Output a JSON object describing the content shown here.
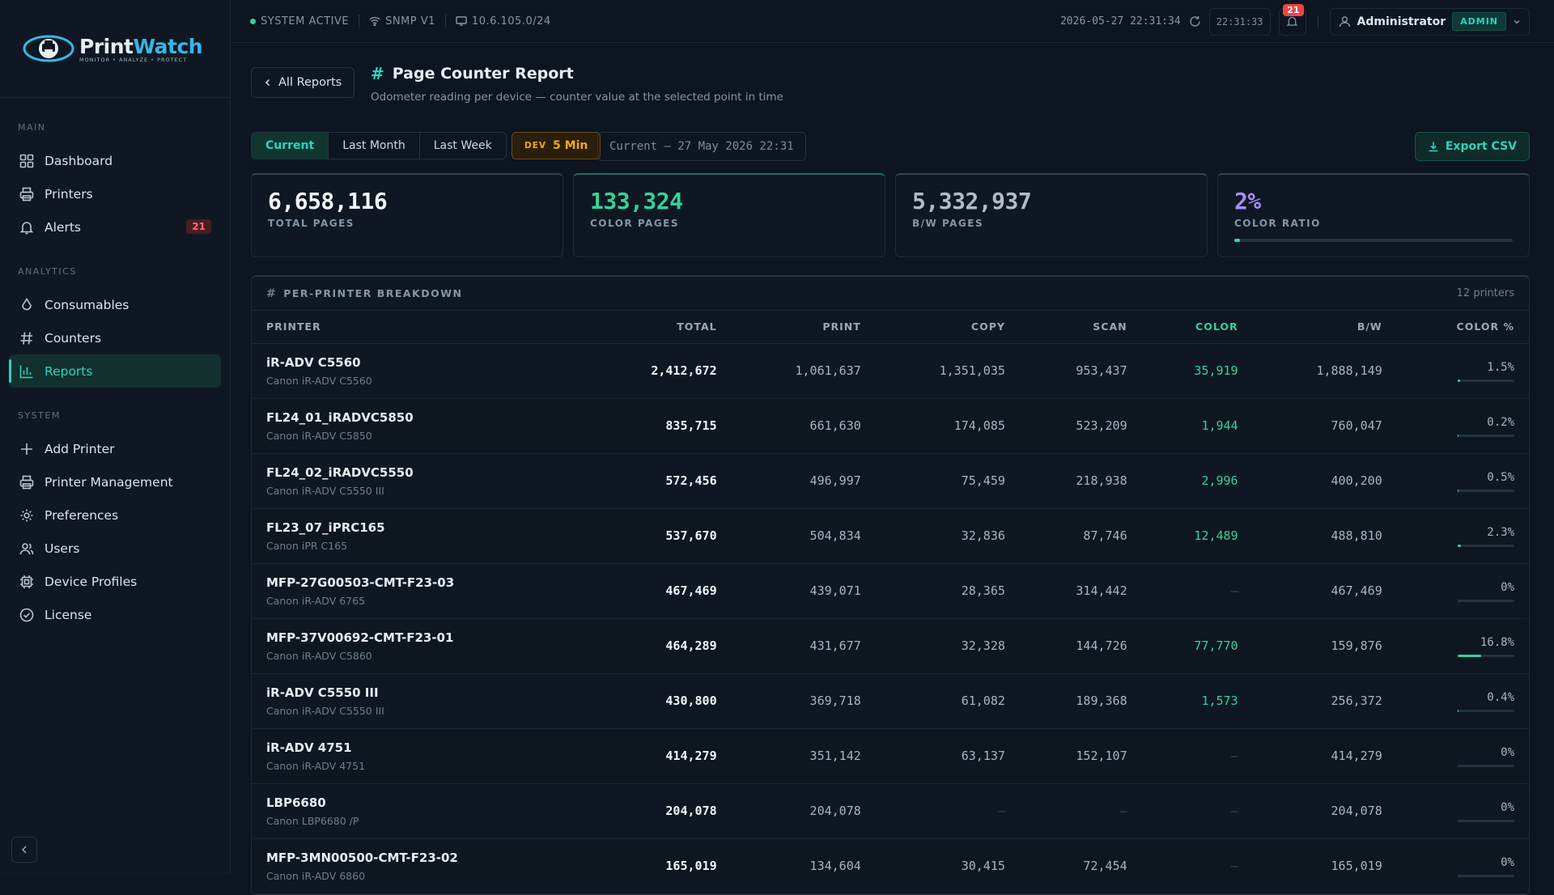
{
  "brand": {
    "name_part1": "Print",
    "name_part2": "Watch",
    "tagline": "MONITOR • ANALYZE • PROTECT"
  },
  "sidebar": {
    "sections": [
      {
        "label": "MAIN",
        "items": [
          {
            "label": "Dashboard",
            "icon": "grid-icon"
          },
          {
            "label": "Printers",
            "icon": "printer-icon"
          },
          {
            "label": "Alerts",
            "icon": "bell-icon",
            "badge": "21"
          }
        ]
      },
      {
        "label": "ANALYTICS",
        "items": [
          {
            "label": "Consumables",
            "icon": "droplet-icon"
          },
          {
            "label": "Counters",
            "icon": "hash-icon"
          },
          {
            "label": "Reports",
            "icon": "bar-chart-icon",
            "active": true
          }
        ]
      },
      {
        "label": "SYSTEM",
        "items": [
          {
            "label": "Add Printer",
            "icon": "plus-icon"
          },
          {
            "label": "Printer Management",
            "icon": "printer-icon"
          },
          {
            "label": "Preferences",
            "icon": "gear-icon"
          },
          {
            "label": "Users",
            "icon": "users-icon"
          },
          {
            "label": "Device Profiles",
            "icon": "chip-icon"
          },
          {
            "label": "License",
            "icon": "check-circle-icon"
          }
        ]
      }
    ]
  },
  "topbar": {
    "status": "SYSTEM ACTIVE",
    "protocol": "SNMP V1",
    "subnet": "10.6.105.0/24",
    "datetime": "2026-05-27 22:31:34",
    "refresh_time": "22:31:33",
    "notifications": "21",
    "user": "Administrator",
    "role": "ADMIN"
  },
  "header": {
    "back_label": "All Reports",
    "title": "Page Counter Report",
    "subtitle": "Odometer reading per device — counter value at the selected point in time"
  },
  "filters": {
    "periods": [
      "Current",
      "Last Month",
      "Last Week"
    ],
    "active_period": "Current",
    "dev_tag": "DEV",
    "dev_label": "5 Min",
    "date_value": "Current — 27 May 2026 22:31",
    "export_label": "Export CSV"
  },
  "stats": {
    "total_pages": {
      "value": "6,658,116",
      "label": "TOTAL PAGES"
    },
    "color_pages": {
      "value": "133,324",
      "label": "COLOR PAGES"
    },
    "bw_pages": {
      "value": "5,332,937",
      "label": "B/W PAGES"
    },
    "color_ratio": {
      "value": "2%",
      "label": "COLOR RATIO",
      "fraction": 0.02
    }
  },
  "breakdown": {
    "title": "PER-PRINTER BREAKDOWN",
    "count": "12 printers",
    "columns": [
      "PRINTER",
      "TOTAL",
      "PRINT",
      "COPY",
      "SCAN",
      "COLOR",
      "B/W",
      "COLOR %"
    ],
    "rows": [
      {
        "name": "iR-ADV C5560",
        "model": "Canon iR-ADV C5560",
        "total": "2,412,672",
        "print": "1,061,637",
        "copy": "1,351,035",
        "scan": "953,437",
        "color": "35,919",
        "bw": "1,888,149",
        "pct": "1.5%",
        "pct_num": 1.5
      },
      {
        "name": "FL24_01_iRADVC5850",
        "model": "Canon iR-ADV C5850",
        "total": "835,715",
        "print": "661,630",
        "copy": "174,085",
        "scan": "523,209",
        "color": "1,944",
        "bw": "760,047",
        "pct": "0.2%",
        "pct_num": 0.2
      },
      {
        "name": "FL24_02_iRADVC5550",
        "model": "Canon iR-ADV C5550 III",
        "total": "572,456",
        "print": "496,997",
        "copy": "75,459",
        "scan": "218,938",
        "color": "2,996",
        "bw": "400,200",
        "pct": "0.5%",
        "pct_num": 0.5
      },
      {
        "name": "FL23_07_iPRC165",
        "model": "Canon iPR C165",
        "total": "537,670",
        "print": "504,834",
        "copy": "32,836",
        "scan": "87,746",
        "color": "12,489",
        "bw": "488,810",
        "pct": "2.3%",
        "pct_num": 2.3
      },
      {
        "name": "MFP-27G00503-CMT-F23-03",
        "model": "Canon iR-ADV 6765",
        "total": "467,469",
        "print": "439,071",
        "copy": "28,365",
        "scan": "314,442",
        "color": "—",
        "bw": "467,469",
        "pct": "0%",
        "pct_num": 0
      },
      {
        "name": "MFP-37V00692-CMT-F23-01",
        "model": "Canon iR-ADV C5860",
        "total": "464,289",
        "print": "431,677",
        "copy": "32,328",
        "scan": "144,726",
        "color": "77,770",
        "bw": "159,876",
        "pct": "16.8%",
        "pct_num": 16.8
      },
      {
        "name": "iR-ADV C5550 III",
        "model": "Canon iR-ADV C5550 III",
        "total": "430,800",
        "print": "369,718",
        "copy": "61,082",
        "scan": "189,368",
        "color": "1,573",
        "bw": "256,372",
        "pct": "0.4%",
        "pct_num": 0.4
      },
      {
        "name": "iR-ADV 4751",
        "model": "Canon iR-ADV 4751",
        "total": "414,279",
        "print": "351,142",
        "copy": "63,137",
        "scan": "152,107",
        "color": "—",
        "bw": "414,279",
        "pct": "0%",
        "pct_num": 0
      },
      {
        "name": "LBP6680",
        "model": "Canon LBP6680 /P",
        "total": "204,078",
        "print": "204,078",
        "copy": "—",
        "scan": "—",
        "color": "—",
        "bw": "204,078",
        "pct": "0%",
        "pct_num": 0
      },
      {
        "name": "MFP-3MN00500-CMT-F23-02",
        "model": "Canon iR-ADV 6860",
        "total": "165,019",
        "print": "134,604",
        "copy": "30,415",
        "scan": "72,454",
        "color": "—",
        "bw": "165,019",
        "pct": "0%",
        "pct_num": 0
      }
    ]
  },
  "colors": {
    "accent": "#2dd4bf",
    "green": "#34d399",
    "warning": "#f5a623",
    "danger": "#ef4444",
    "purple": "#a78bfa"
  }
}
